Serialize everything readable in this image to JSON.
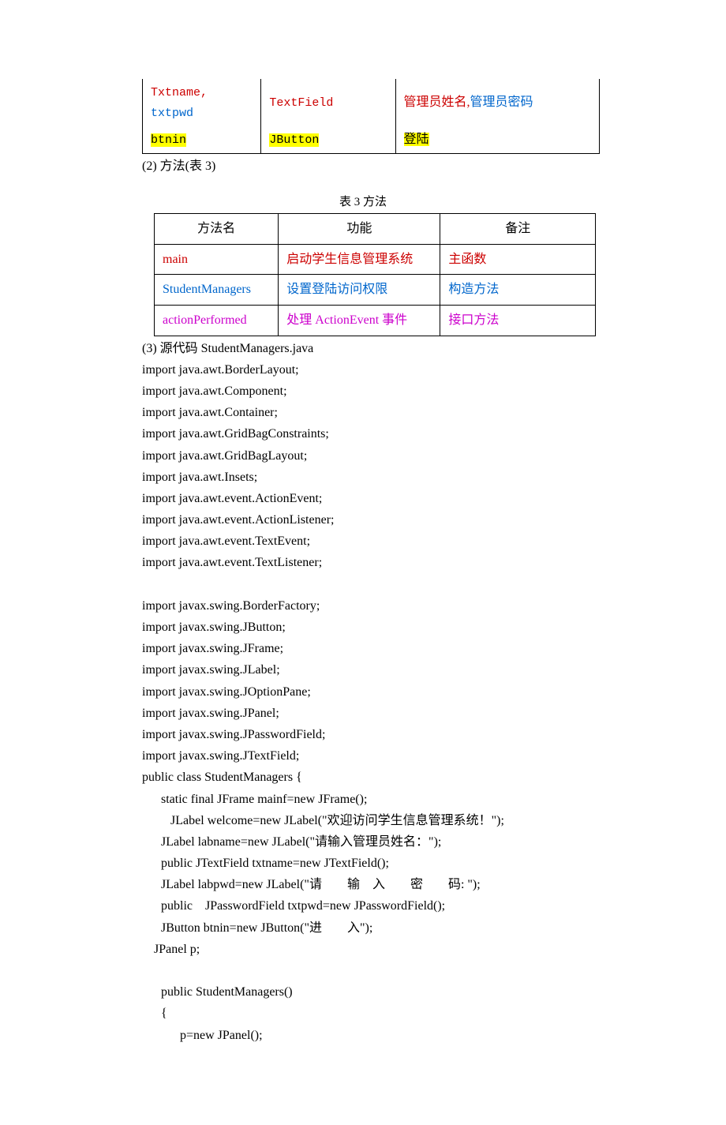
{
  "topTable": {
    "row1": {
      "c1a": "Txtname, ",
      "c1b": "txtpwd",
      "c2": "TextField",
      "c3a": "管理员姓名,",
      "c3b": "管理员密码"
    },
    "row2": {
      "c1": "btnin",
      "c2": "JButton",
      "c3": "登陆"
    }
  },
  "afterTop": "(2)  方法(表 3)",
  "table3Caption": "表 3  方法",
  "table3": {
    "header": {
      "h1": "方法名",
      "h2": "功能",
      "h3": "备注"
    },
    "rows": [
      {
        "c1": "main",
        "c2": "启动学生信息管理系统",
        "c3": "主函数",
        "c1cls": "red",
        "c2cls": "red",
        "c3cls": "red"
      },
      {
        "c1": "StudentManagers",
        "c2": "设置登陆访问权限",
        "c3": "构造方法",
        "c1cls": "blue",
        "c2cls": "blue",
        "c3cls": "blue"
      },
      {
        "c1": "actionPerformed",
        "c2": "处理 ActionEvent 事件",
        "c3": "接口方法",
        "c1cls": "magenta",
        "c2cls": "magenta",
        "c3cls": "magenta"
      }
    ]
  },
  "code": {
    "l0": "(3)  源代码  StudentManagers.java",
    "l1": "import java.awt.BorderLayout;",
    "l2": "import java.awt.Component;",
    "l3": "import java.awt.Container;",
    "l4": "import java.awt.GridBagConstraints;",
    "l5": "import java.awt.GridBagLayout;",
    "l6": "import java.awt.Insets;",
    "l7": "import java.awt.event.ActionEvent;",
    "l8": "import java.awt.event.ActionListener;",
    "l9": "import java.awt.event.TextEvent;",
    "l10": "import java.awt.event.TextListener;",
    "l11": "",
    "l12": "import javax.swing.BorderFactory;",
    "l13": "import javax.swing.JButton;",
    "l14": "import javax.swing.JFrame;",
    "l15": "import javax.swing.JLabel;",
    "l16": "import javax.swing.JOptionPane;",
    "l17": "import javax.swing.JPanel;",
    "l18": "import javax.swing.JPasswordField;",
    "l19": "import javax.swing.JTextField;",
    "l20": "public class StudentManagers {",
    "l21": "static final JFrame mainf=new JFrame();",
    "l22": "JLabel welcome=new JLabel(\"欢迎访问学生信息管理系统！\");",
    "l23": "JLabel labname=new JLabel(\"请输入管理员姓名：\");",
    "l24": "public JTextField txtname=new JTextField();",
    "l25": "JLabel labpwd=new JLabel(\"请  输 入  密  码: \");",
    "l26": "public JPasswordField txtpwd=new JPasswordField();",
    "l27": "JButton btnin=new JButton(\"进  入\");",
    "l28": "JPanel p;",
    "l29": "",
    "l30": "public StudentManagers()",
    "l31": "{",
    "l32": "p=new JPanel();"
  }
}
